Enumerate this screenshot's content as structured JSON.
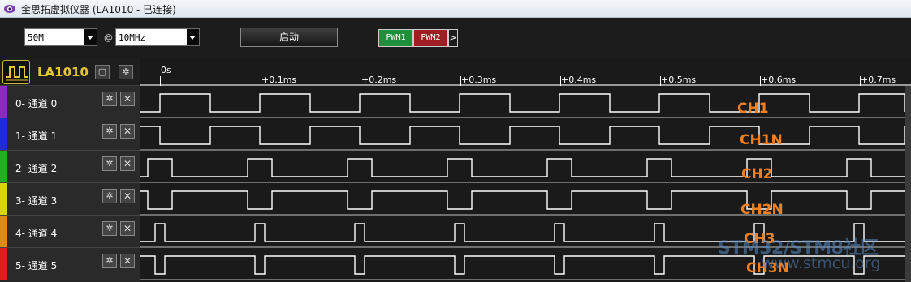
{
  "window": {
    "title": "金思拓虚拟仪器 (LA1010 - 已连接)",
    "icon": "app-eye-icon"
  },
  "toolbar": {
    "sample_count": "50M",
    "at_symbol": "@",
    "sample_rate": "10MHz",
    "start_label": "启动",
    "pwm1_label": "PWM1",
    "pwm2_label": "PWM2",
    "more_label": ">",
    "pwm1_color": "#1e8f3a",
    "pwm2_color": "#9e1e24"
  },
  "device": {
    "name": "LA1010",
    "name_color": "#e5c53a",
    "icon": "waveform-icon"
  },
  "channels": [
    {
      "label": "0- 通道 0",
      "color": "#8b2bc6",
      "annotation": "CH1"
    },
    {
      "label": "1- 通道 1",
      "color": "#1e2bd6",
      "annotation": "CH1N"
    },
    {
      "label": "2- 通道 2",
      "color": "#1fb21f",
      "annotation": "CH2"
    },
    {
      "label": "3- 通道 3",
      "color": "#d8d414",
      "annotation": "CH2N"
    },
    {
      "label": "4- 通道 4",
      "color": "#e08a12",
      "annotation": "CH3"
    },
    {
      "label": "5- 通道 5",
      "color": "#d8201e",
      "annotation": "CH3N"
    }
  ],
  "timeline": {
    "ticks": [
      "0s",
      "+0.1ms",
      "+0.2ms",
      "+0.3ms",
      "+0.4ms",
      "+0.5ms",
      "+0.6ms",
      "+0.7ms"
    ]
  },
  "watermark": {
    "line1": "STM32/STM8社区",
    "line2": "www.stmcu.org"
  },
  "annotation_color": "#f08020"
}
